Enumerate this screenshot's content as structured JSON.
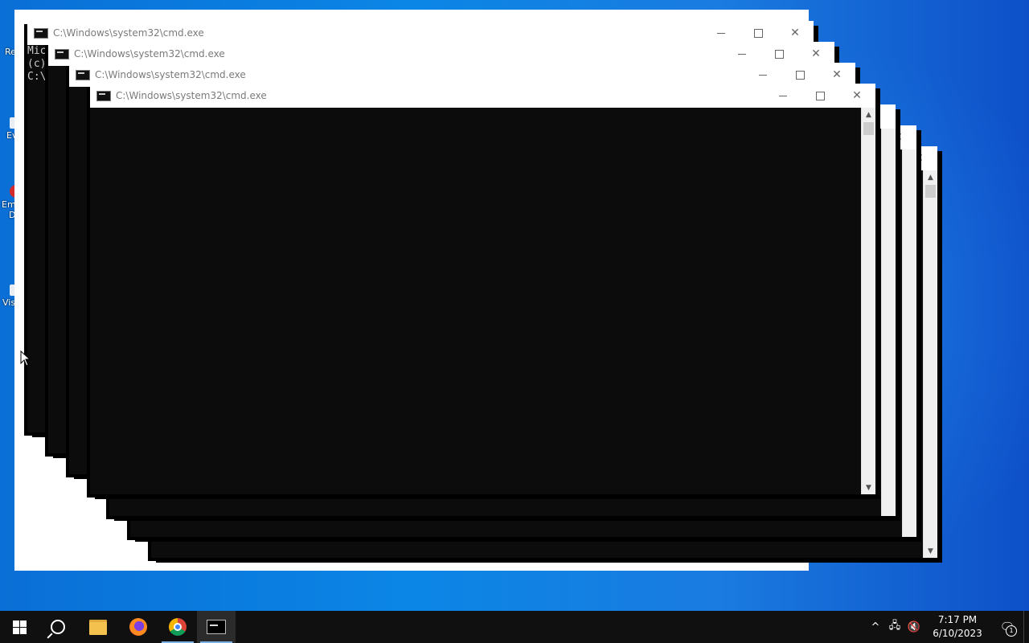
{
  "window_title": "C:\\Windows\\system32\\cmd.exe",
  "console_lines": [
    "Mic",
    "(c)",
    "",
    "C:\\"
  ],
  "desktop_icons": [
    {
      "label": "Re"
    },
    {
      "label": "Ev"
    },
    {
      "label": "Em"
    },
    {
      "label": "D"
    },
    {
      "label": "Vis"
    }
  ],
  "taskbar": {
    "pinned": [
      "start-icon",
      "search-icon",
      "file-explorer-icon",
      "firefox-icon",
      "chrome-icon",
      "command-prompt-icon"
    ],
    "time": "7:17 PM",
    "date": "6/10/2023",
    "notification_count": "1"
  },
  "colors": {
    "console_bg": "#0c0c0c",
    "title_text": "#7a7a7a",
    "taskbar": "#101010",
    "desktop": "#0b86e6"
  }
}
